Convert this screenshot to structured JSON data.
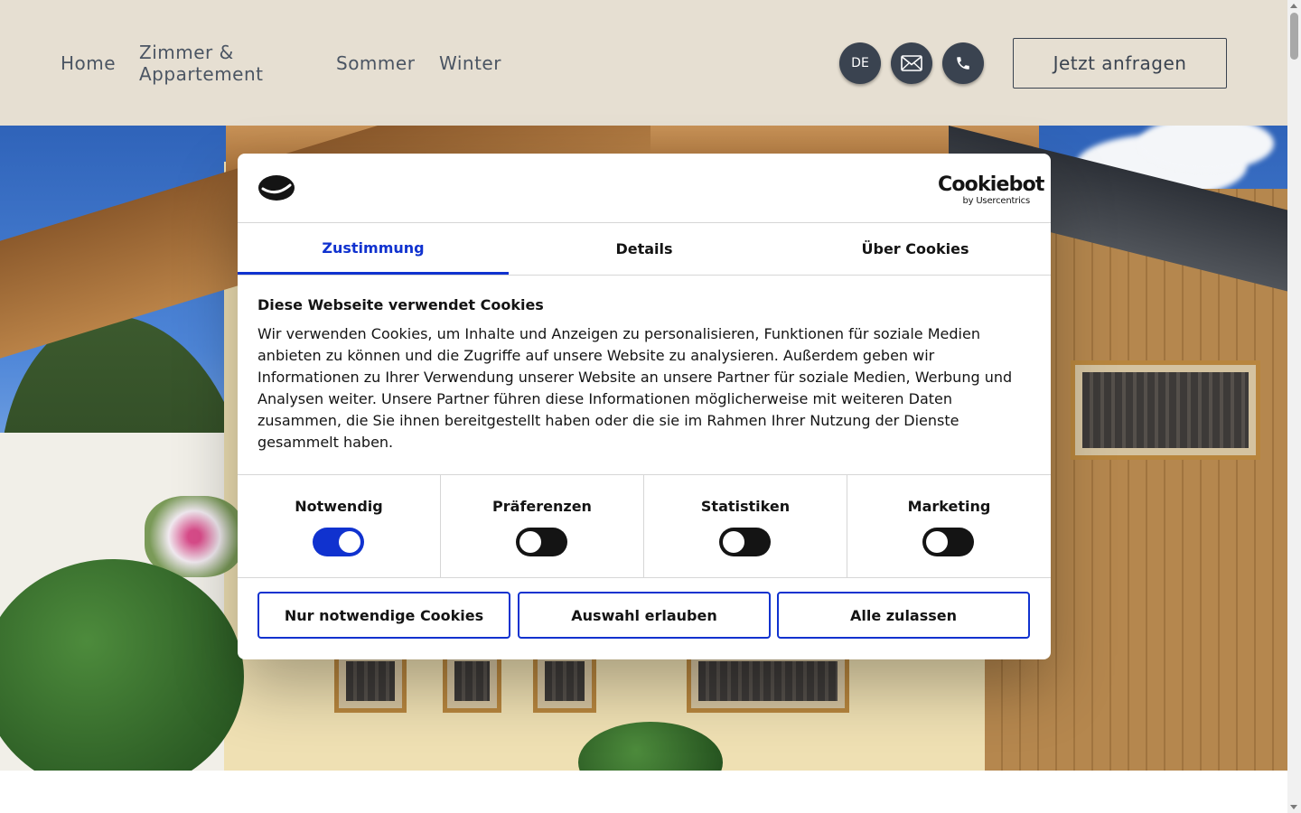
{
  "nav": {
    "items": [
      {
        "label": "Home"
      },
      {
        "label": "Zimmer & Appartement"
      },
      {
        "label": "Sommer"
      },
      {
        "label": "Winter"
      }
    ],
    "language": "DE",
    "mail_icon": "envelope-icon",
    "phone_icon": "phone-icon",
    "cta_label": "Jetzt anfragen"
  },
  "cookie_dialog": {
    "brand": {
      "main": "Cookiebot",
      "sub": "by Usercentrics"
    },
    "tabs": [
      {
        "label": "Zustimmung",
        "active": true
      },
      {
        "label": "Details",
        "active": false
      },
      {
        "label": "Über Cookies",
        "active": false
      }
    ],
    "title": "Diese Webseite verwendet Cookies",
    "body": "Wir verwenden Cookies, um Inhalte und Anzeigen zu personalisieren, Funktionen für soziale Medien anbieten zu können und die Zugriffe auf unsere Website zu analysieren. Außerdem geben wir Informationen zu Ihrer Verwendung unserer Website an unsere Partner für soziale Medien, Werbung und Analysen weiter. Unsere Partner führen diese Informationen möglicherweise mit weiteren Daten zusammen, die Sie ihnen bereitgestellt haben oder die sie im Rahmen Ihrer Nutzung der Dienste gesammelt haben.",
    "categories": [
      {
        "label": "Notwendig",
        "enabled": true
      },
      {
        "label": "Präferenzen",
        "enabled": false
      },
      {
        "label": "Statistiken",
        "enabled": false
      },
      {
        "label": "Marketing",
        "enabled": false
      }
    ],
    "buttons": {
      "necessary": "Nur notwendige Cookies",
      "selection": "Auswahl erlauben",
      "all": "Alle zulassen"
    }
  },
  "colors": {
    "header_bg": "#e6dfd2",
    "accent": "#1032cf",
    "dark_button": "#3a4350"
  }
}
